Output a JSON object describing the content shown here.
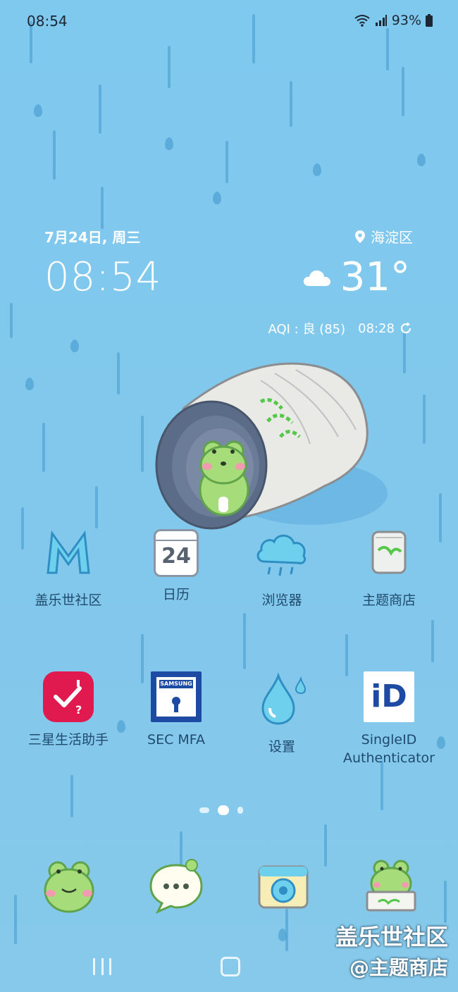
{
  "status_bar": {
    "time": "08:54",
    "battery": "93%"
  },
  "weather_widget": {
    "date": "7月24日, 周三",
    "time": "08:54",
    "location": "海淀区",
    "temperature": "31°",
    "aqi": "AQI : 良 (85)",
    "updated": "08:28",
    "condition_icon": "cloud-icon"
  },
  "apps_row1": [
    {
      "label": "盖乐世社区",
      "icon": "community-m-icon"
    },
    {
      "label": "日历",
      "icon": "calendar-icon",
      "day": "24"
    },
    {
      "label": "浏览器",
      "icon": "cloud-browser-icon"
    },
    {
      "label": "主题商店",
      "icon": "theme-store-icon"
    }
  ],
  "apps_row2": [
    {
      "label": "三星生活助手",
      "icon": "samsung-assistant-icon"
    },
    {
      "label": "SEC MFA",
      "icon": "sec-mfa-icon",
      "brand": "SAMSUNG"
    },
    {
      "label": "设置",
      "icon": "water-drop-settings-icon"
    },
    {
      "label": "SingleID Authenticator",
      "icon": "singleid-icon",
      "brand": "iD"
    }
  ],
  "dock": [
    {
      "icon": "frog-phone-icon"
    },
    {
      "icon": "frog-messages-icon"
    },
    {
      "icon": "camera-icon"
    },
    {
      "icon": "frog-gallery-icon"
    }
  ],
  "watermark": {
    "line1": "盖乐世社区",
    "line2": "@主题商店"
  },
  "colors": {
    "sky": "#7fc8ee",
    "rain": "#4d9fd3",
    "frog": "#a7dc7a",
    "label": "#1f4a6d"
  }
}
